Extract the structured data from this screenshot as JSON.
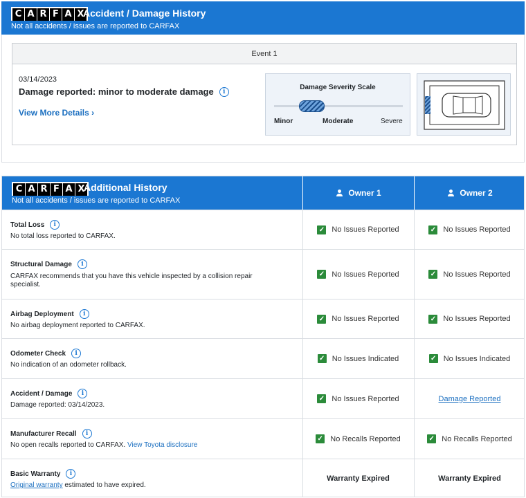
{
  "brand": {
    "logo_letters": [
      "C",
      "A",
      "R",
      "F",
      "A",
      "X"
    ]
  },
  "accident_section": {
    "title": "Accident / Damage History",
    "subtitle": "Not all accidents / issues are reported to CARFAX",
    "event_label": "Event 1",
    "date": "03/14/2023",
    "headline": "Damage reported: minor to moderate damage",
    "more_link": "View More Details ›",
    "severity": {
      "title": "Damage Severity Scale",
      "labels": [
        "Minor",
        "Moderate",
        "Severe"
      ],
      "level": "Minor to Moderate"
    }
  },
  "additional_section": {
    "title": "Additional History",
    "subtitle": "Not all accidents / issues are reported to CARFAX",
    "owners": [
      "Owner 1",
      "Owner 2"
    ],
    "rows": [
      {
        "label": "Total Loss",
        "desc": "No total loss reported to CARFAX.",
        "owner1": "No Issues Reported",
        "owner2": "No Issues Reported"
      },
      {
        "label": "Structural Damage",
        "desc": "CARFAX recommends that you have this vehicle inspected by a collision repair specialist.",
        "owner1": "No Issues Reported",
        "owner2": "No Issues Reported"
      },
      {
        "label": "Airbag Deployment",
        "desc": "No airbag deployment reported to CARFAX.",
        "owner1": "No Issues Reported",
        "owner2": "No Issues Reported"
      },
      {
        "label": "Odometer Check",
        "desc": "No indication of an odometer rollback.",
        "owner1": "No Issues Indicated",
        "owner2": "No Issues Indicated"
      },
      {
        "label": "Accident / Damage",
        "desc": "Damage reported: 03/14/2023.",
        "owner1": "No Issues Reported",
        "owner2": "Damage Reported"
      },
      {
        "label": "Manufacturer Recall",
        "desc": "No open recalls reported to CARFAX.",
        "desc_link": "View Toyota disclosure",
        "owner1": "No Recalls Reported",
        "owner2": "No Recalls Reported"
      },
      {
        "label": "Basic Warranty",
        "desc_link": "Original warranty",
        "desc": "estimated to have expired.",
        "owner1": "Warranty Expired",
        "owner2": "Warranty Expired"
      }
    ]
  },
  "colors": {
    "brand_blue": "#1b77d2",
    "check_green": "#2b8b3a",
    "link_blue": "#1b6fc0"
  },
  "icons": [
    "info-icon",
    "check-icon",
    "person-icon",
    "car-icon"
  ]
}
